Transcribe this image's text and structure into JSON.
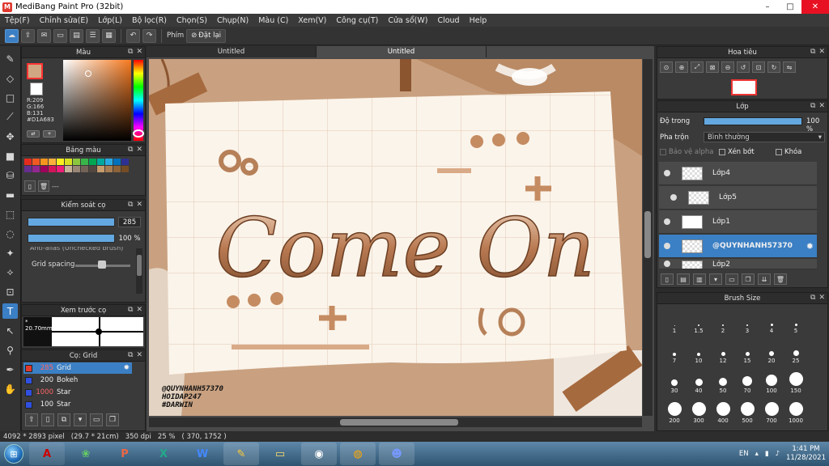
{
  "window": {
    "title": "MediBang Paint Pro (32bit)",
    "buttons": [
      "–",
      "□",
      "✕"
    ]
  },
  "menu": [
    "Tệp(F)",
    "Chỉnh sửa(E)",
    "Lớp(L)",
    "Bộ lọc(R)",
    "Chọn(S)",
    "Chụp(N)",
    "Màu (C)",
    "Xem(V)",
    "Công cụ(T)",
    "Cửa sổ(W)",
    "Cloud",
    "Help"
  ],
  "toolbar": {
    "tool_label": "Phím",
    "reset_label": "Đặt lại"
  },
  "color_panel": {
    "title": "Màu",
    "rgb_text": "R:209\nG:166\nB:131\n#D1A683",
    "fg_color": "#D1A683"
  },
  "palette_panel": {
    "title": "Bảng màu",
    "extra": "---",
    "colors": [
      "#e52b1f",
      "#f05a22",
      "#f7941d",
      "#fbb03b",
      "#fcee21",
      "#d9e021",
      "#8cc63f",
      "#39b54a",
      "#00a651",
      "#00a99d",
      "#29abe2",
      "#0071bc",
      "#2e3192",
      "#662d91",
      "#93278f",
      "#9e005d",
      "#d4145a",
      "#ed1e79",
      "#c7b299",
      "#998675",
      "#736357",
      "#534741",
      "#c69c6d",
      "#a67c52",
      "#8c6239",
      "#754c24"
    ]
  },
  "brush_control": {
    "title": "Kiểm soát cọ",
    "size_value": "285",
    "opacity_value": "100 %",
    "grid_spacing_label": "Grid spacing",
    "hidden_label": "Anti-alias (Unchecked brush)"
  },
  "brush_preview": {
    "title": "Xem trước cọ",
    "size_text": "* 20.70mm"
  },
  "brush_list": {
    "title": "Cọ: Grid",
    "items": [
      {
        "size": "285",
        "name": "Grid",
        "color": "#e03a2e",
        "selected": true
      },
      {
        "size": "200",
        "name": "Bokeh",
        "color": "#3050e0",
        "selected": false
      },
      {
        "size": "1000",
        "name": "Star",
        "color": "#3050e0",
        "selected": false
      },
      {
        "size": "100",
        "name": "Star",
        "color": "#3050e0",
        "selected": false
      }
    ]
  },
  "tabs": [
    "Untitled",
    "Untitled"
  ],
  "canvas": {
    "main_text": "Come On",
    "credit_lines": [
      "@QUYNHANH57370",
      "HOIDAP247",
      "#DARWIN"
    ]
  },
  "navigator": {
    "title": "Hoa tiêu"
  },
  "layers": {
    "title": "Lớp",
    "opacity_label": "Độ trong",
    "opacity_value": "100 %",
    "blend_label": "Pha trộn",
    "blend_value": "Bình thường",
    "protect_alpha": "Bảo vệ alpha",
    "clip": "Xén bớt",
    "lock": "Khóa",
    "items": [
      {
        "name": "Lớp4",
        "selected": false,
        "indent": false
      },
      {
        "name": "Lớp5",
        "selected": false,
        "indent": true
      },
      {
        "name": "Lớp1",
        "selected": false,
        "indent": false
      },
      {
        "name": "@QUYNHANH57370",
        "selected": true,
        "indent": false
      },
      {
        "name": "Lớp2",
        "selected": false,
        "indent": false
      }
    ]
  },
  "brush_size": {
    "title": "Brush Size",
    "sizes": [
      "1",
      "1.5",
      "2",
      "3",
      "4",
      "5",
      "7",
      "10",
      "12",
      "15",
      "20",
      "25",
      "30",
      "40",
      "50",
      "70",
      "100",
      "150",
      "200",
      "300",
      "400",
      "500",
      "700",
      "1000"
    ]
  },
  "status": {
    "dimensions": "4092 * 2893 pixel",
    "paper": "(29.7 * 21cm)",
    "dpi": "350 dpi",
    "zoom": "25 %",
    "coords": "( 370, 1752 )"
  },
  "taskbar": {
    "lang": "EN",
    "time": "1:41 PM",
    "date": "11/28/2021"
  }
}
